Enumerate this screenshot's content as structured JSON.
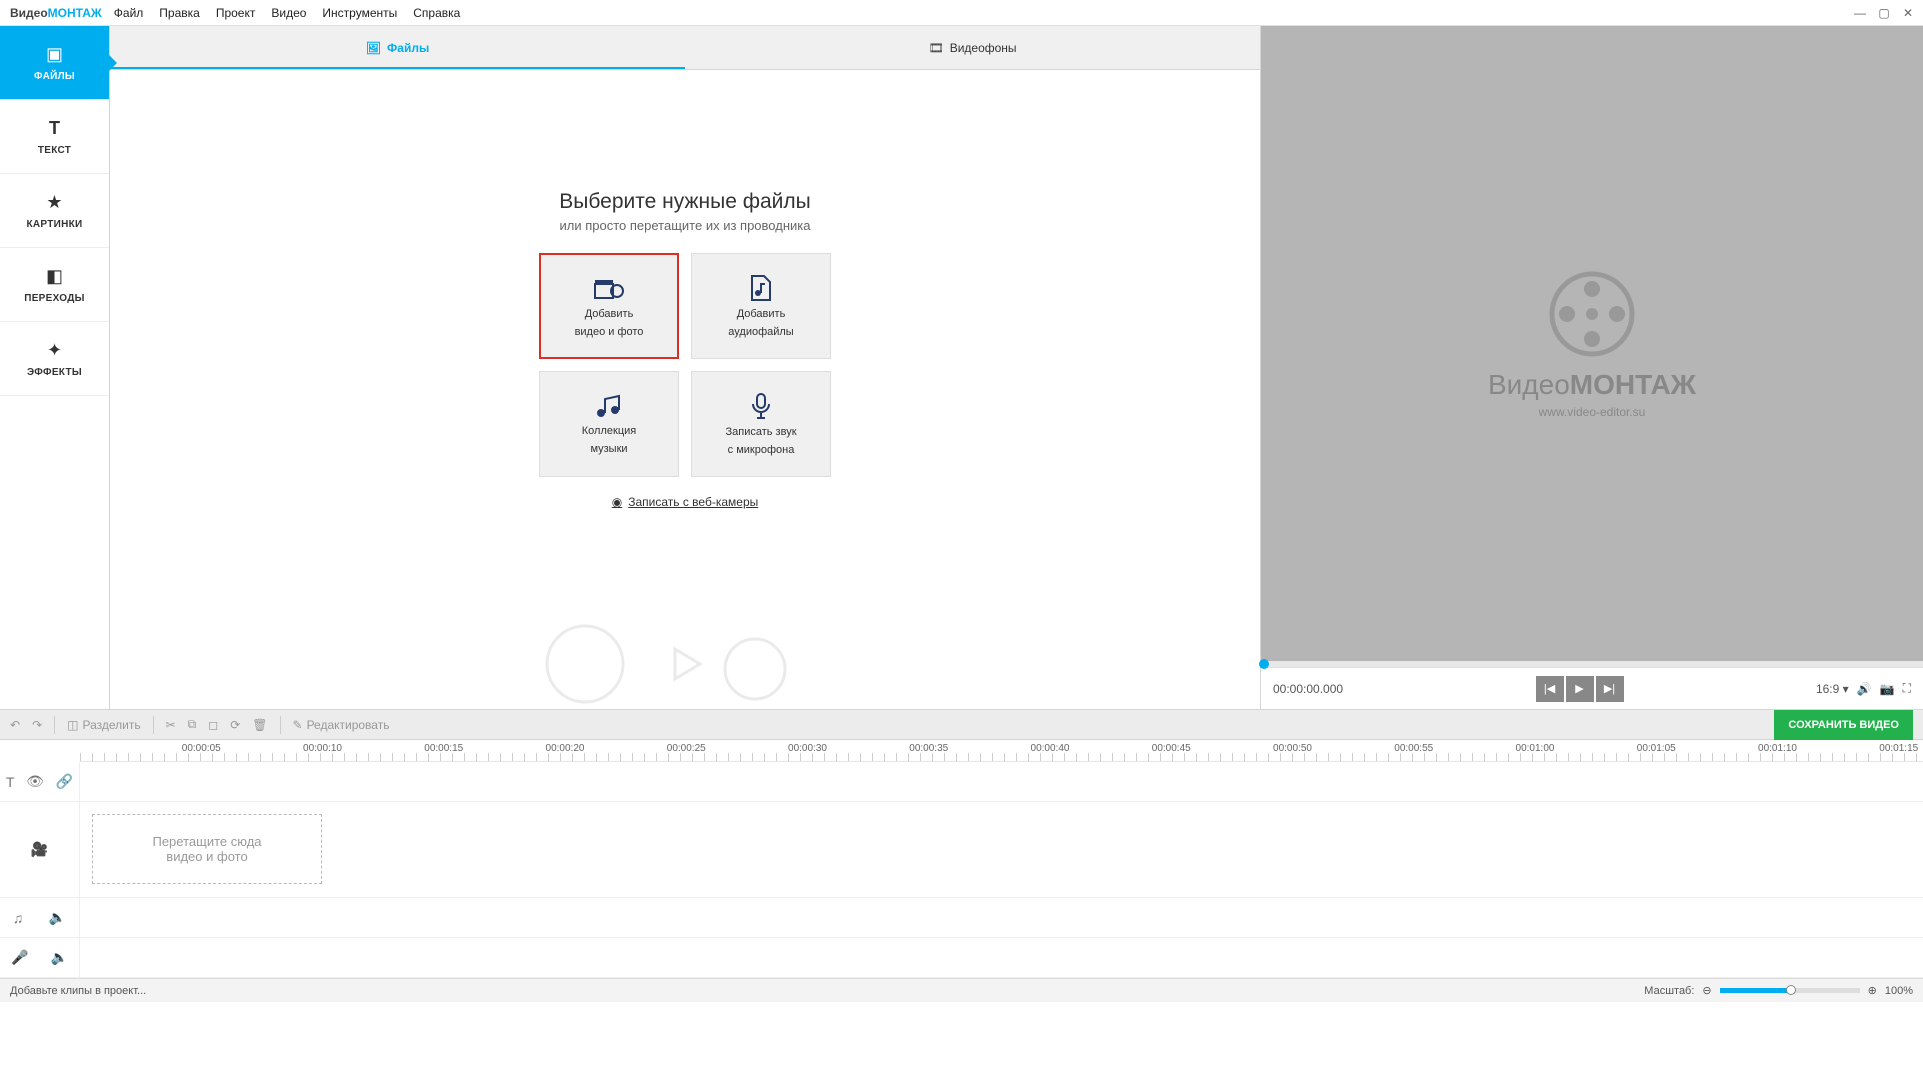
{
  "app": {
    "name_p1": "Видео",
    "name_p2": "МОНТАЖ"
  },
  "menu": {
    "file": "Файл",
    "edit": "Правка",
    "project": "Проект",
    "video": "Видео",
    "tools": "Инструменты",
    "help": "Справка"
  },
  "sidebar": {
    "files": "ФАЙЛЫ",
    "text": "ТЕКСТ",
    "pictures": "КАРТИНКИ",
    "transitions": "ПЕРЕХОДЫ",
    "effects": "ЭФФЕКТЫ"
  },
  "tabs": {
    "files": "Файлы",
    "backgrounds": "Видеофоны"
  },
  "filearea": {
    "title": "Выберите нужные файлы",
    "subtitle": "или просто перетащите их из проводника",
    "btn_add_video_l1": "Добавить",
    "btn_add_video_l2": "видео и фото",
    "btn_add_audio_l1": "Добавить",
    "btn_add_audio_l2": "аудиофайлы",
    "btn_music_l1": "Коллекция",
    "btn_music_l2": "музыки",
    "btn_record_l1": "Записать звук",
    "btn_record_l2": "с микрофона",
    "webcam": "Записать с веб-камеры"
  },
  "preview": {
    "logo_p1": "Видео",
    "logo_p2": "МОНТАЖ",
    "site": "www.video-editor.su",
    "timecode": "00:00:00.000",
    "ratio": "16:9"
  },
  "toolbar": {
    "split": "Разделить",
    "edit": "Редактировать",
    "save": "СОХРАНИТЬ ВИДЕО"
  },
  "ruler": [
    "00:00:05",
    "00:00:10",
    "00:00:15",
    "00:00:20",
    "00:00:25",
    "00:00:30",
    "00:00:35",
    "00:00:40",
    "00:00:45",
    "00:00:50",
    "00:00:55",
    "00:01:00",
    "00:01:05",
    "00:01:10",
    "00:01:15"
  ],
  "dropzone": {
    "l1": "Перетащите сюда",
    "l2": "видео и фото"
  },
  "status": {
    "hint": "Добавьте клипы в проект...",
    "zoom_label": "Масштаб:",
    "zoom_pct": "100%"
  }
}
